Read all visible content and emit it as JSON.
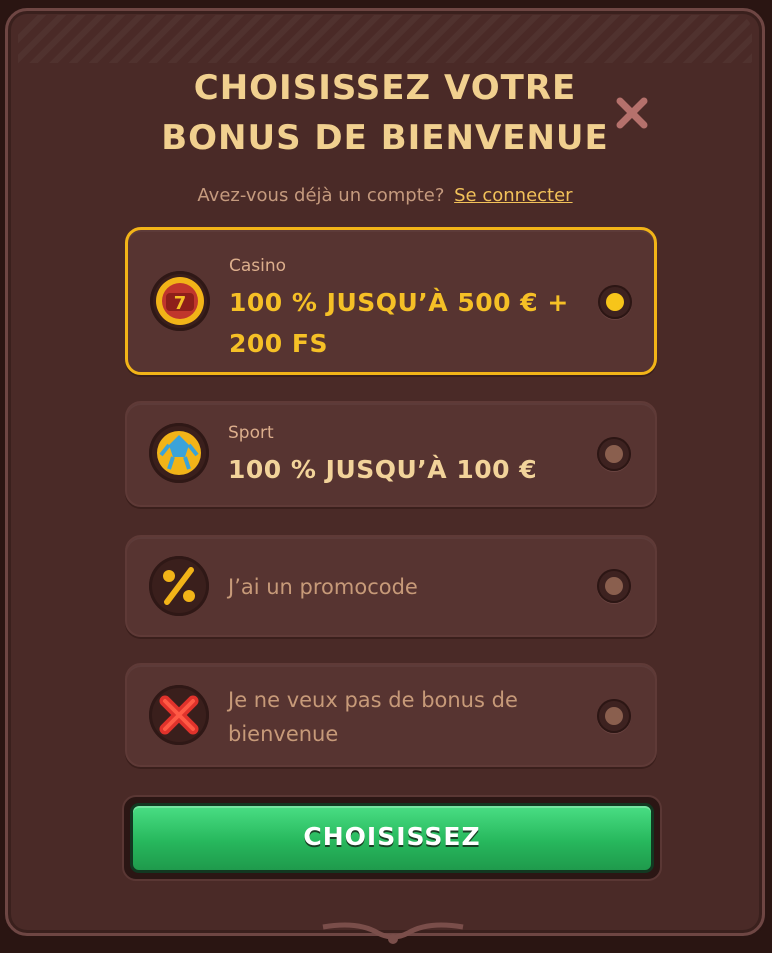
{
  "modal": {
    "title_line1": "CHOISISSEZ VOTRE",
    "title_line2": "BONUS DE BIENVENUE",
    "subtitle": "Avez-vous déjà un compte?",
    "login_link": "Se connecter"
  },
  "options": [
    {
      "category": "Casino",
      "label": "100 % JUSQU’À 500 € + 200 FS",
      "icon": "slot-reel-icon",
      "selected": true
    },
    {
      "category": "Sport",
      "label": "100 % JUSQU’À 100 €",
      "icon": "soccer-ball-icon",
      "selected": false
    },
    {
      "text": "J’ai un promocode",
      "icon": "percent-icon",
      "selected": false
    },
    {
      "text": "Je ne veux pas de bonus de bienvenue",
      "icon": "red-cross-icon",
      "selected": false
    }
  ],
  "cta": {
    "label": "CHOISISSEZ"
  },
  "colors": {
    "accent": "#f2b418",
    "button": "#2fbf63",
    "background": "#4a2a27"
  }
}
